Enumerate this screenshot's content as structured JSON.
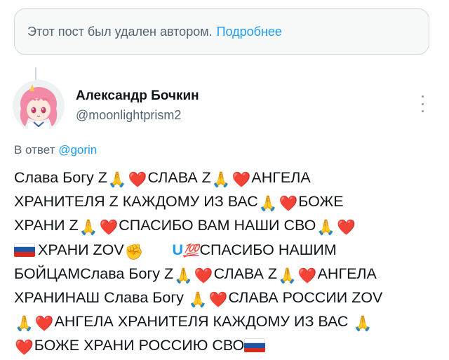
{
  "deleted_notice": {
    "text": "Этот пост был удален автором.",
    "link": "Подробнее"
  },
  "author": {
    "name": "Александр Бочкин",
    "handle": "@moonlightprism2"
  },
  "reply": {
    "prefix": "В ответ",
    "mention": "@gorin"
  },
  "tweet": {
    "segments": {
      "s1": "Слава Богу Z",
      "s2": "СЛАВА Z",
      "s3": "АНГЕЛА",
      "s4": "ХРАНИТЕЛЯ Z КАЖДОМУ ИЗ ВАС",
      "s5": "БОЖЕ",
      "s6": "ХРАНИ Z",
      "s7": "СПАСИБО ВАМ НАШИ СВО",
      "s8": "ХРАНИ ZOV",
      "s9": "U",
      "s10": "💯",
      "s11": "СПАСИБО НАШИМ",
      "s12": "БОЙЦАМСлава Богу Z",
      "s13": "СЛАВА Z",
      "s14": "АНГЕЛА",
      "s15": "ХРАНИНАШ Слава Богу",
      "s16": "СЛАВА РОССИИ ZOV",
      "s17": "АНГЕЛА ХРАНИТЕЛЯ КАЖДОМУ ИЗ ВАС",
      "s18": "БОЖЕ ХРАНИ РОССИЮ СВО"
    }
  },
  "colors": {
    "link": "#1d9bf0",
    "muted": "#536471",
    "text": "#0f1419",
    "border": "#cfd9de"
  },
  "icons": [
    "praying-hands-emoji",
    "red-heart-emoji",
    "russian-flag-emoji",
    "raised-fist-emoji",
    "hundred-points-emoji",
    "more-icon"
  ]
}
